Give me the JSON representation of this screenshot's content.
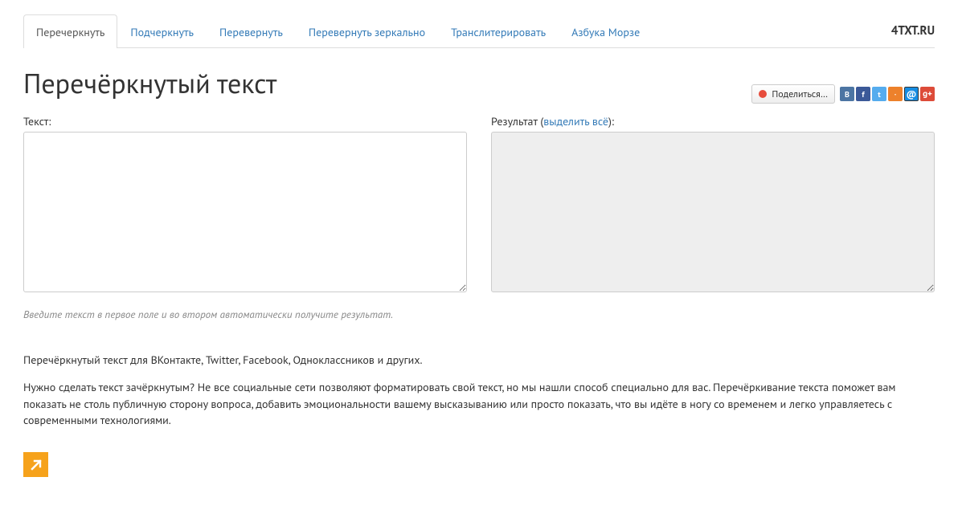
{
  "brand": "4TXT.RU",
  "tabs": [
    {
      "label": "Перечеркнуть",
      "active": true
    },
    {
      "label": "Подчеркнуть",
      "active": false
    },
    {
      "label": "Перевернуть",
      "active": false
    },
    {
      "label": "Перевернуть зеркально",
      "active": false
    },
    {
      "label": "Транслитерировать",
      "active": false
    },
    {
      "label": "Азбука Морзе",
      "active": false
    }
  ],
  "title": "Перечёркнутый текст",
  "share_button": "Поделиться…",
  "share_icons": [
    {
      "name": "vk",
      "glyph": "B",
      "cls": "s-vk"
    },
    {
      "name": "fb",
      "glyph": "f",
      "cls": "s-fb"
    },
    {
      "name": "tw",
      "glyph": "t",
      "cls": "s-tw"
    },
    {
      "name": "ok",
      "glyph": "·",
      "cls": "s-ok"
    },
    {
      "name": "mm",
      "glyph": "@",
      "cls": "s-mm"
    },
    {
      "name": "gp",
      "glyph": "g+",
      "cls": "s-gp"
    }
  ],
  "input_label": "Текст:",
  "result_label_prefix": "Результат (",
  "result_select_all": "выделить всё",
  "result_label_suffix": "):",
  "input_value": "",
  "result_value": "",
  "hint": "Введите текст в первое поле и во втором автоматически получите результат.",
  "para1": "Перечёркнутый текст для ВКонтакте, Twitter, Facebook, Одноклассников и других.",
  "para2": "Нужно сделать текст зачёркнутым? Не все социальные сети позволяют форматировать свой текст, но мы нашли способ специально для вас. Перечёркивание текста поможет вам показать не столь публичную сторону вопроса, добавить эмоциональности вашему высказыванию или просто показать, что вы идёте в ногу со временем и легко управляетесь с современными технологиями."
}
